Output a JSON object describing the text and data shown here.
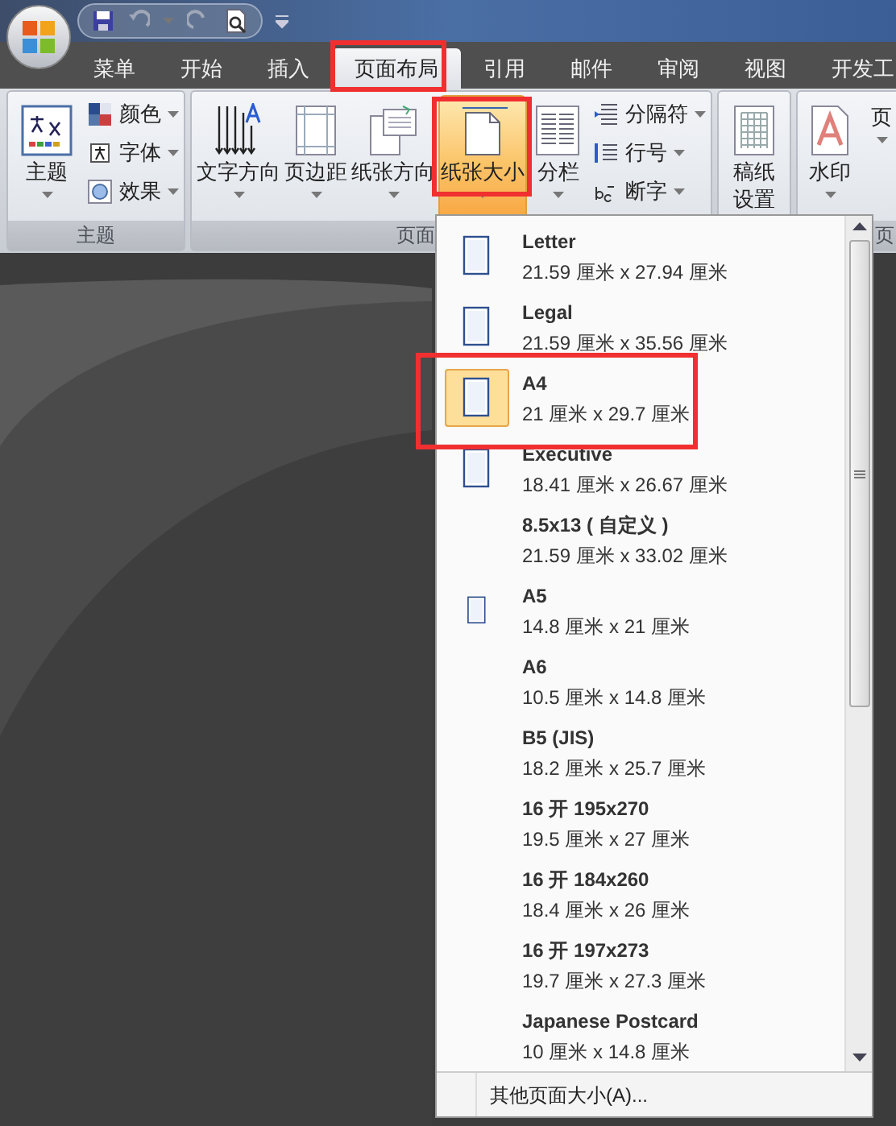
{
  "tabs": [
    {
      "label": "菜单",
      "selected": false
    },
    {
      "label": "开始",
      "selected": false
    },
    {
      "label": "插入",
      "selected": false
    },
    {
      "label": "页面布局",
      "selected": true
    },
    {
      "label": "引用",
      "selected": false
    },
    {
      "label": "邮件",
      "selected": false
    },
    {
      "label": "审阅",
      "selected": false
    },
    {
      "label": "视图",
      "selected": false
    },
    {
      "label": "开发工",
      "selected": false
    }
  ],
  "ribbon": {
    "groups": [
      {
        "label": "主题",
        "controls": [
          {
            "kind": "large",
            "label": "主题",
            "selected": false
          },
          {
            "kind": "small",
            "label": "颜色"
          },
          {
            "kind": "small",
            "label": "字体"
          },
          {
            "kind": "small",
            "label": "效果"
          }
        ]
      },
      {
        "label": "页面",
        "controls": [
          {
            "kind": "large",
            "label": "文字方向",
            "selected": false
          },
          {
            "kind": "large",
            "label": "页边距",
            "selected": false
          },
          {
            "kind": "large",
            "label": "纸张方向",
            "selected": false
          },
          {
            "kind": "large",
            "label": "纸张大小",
            "selected": true
          },
          {
            "kind": "large",
            "label": "分栏",
            "selected": false
          },
          {
            "kind": "small",
            "label": "分隔符"
          },
          {
            "kind": "small",
            "label": "行号"
          },
          {
            "kind": "small",
            "label": "断字"
          }
        ]
      },
      {
        "controls": [
          {
            "kind": "large",
            "label": "稿纸设置",
            "selected": false
          }
        ]
      },
      {
        "label": "页",
        "controls": [
          {
            "kind": "large",
            "label": "水印",
            "selected": false
          },
          {
            "kind": "large",
            "label": "页",
            "selected": false
          }
        ]
      }
    ]
  },
  "paper_menu": {
    "items": [
      {
        "name": "Letter",
        "size": "21.59 厘米 x 27.94 厘米",
        "icon": true,
        "selected": false
      },
      {
        "name": "Legal",
        "size": "21.59 厘米 x 35.56 厘米",
        "icon": true,
        "selected": false
      },
      {
        "name": "A4",
        "size": "21 厘米 x 29.7 厘米",
        "icon": true,
        "selected": true
      },
      {
        "name": "Executive",
        "size": "18.41 厘米 x 26.67 厘米",
        "icon": true,
        "selected": false
      },
      {
        "name": "8.5x13 ( 自定义 )",
        "size": "21.59 厘米 x 33.02 厘米",
        "icon": false,
        "selected": false
      },
      {
        "name": "A5",
        "size": "14.8 厘米 x 21 厘米",
        "icon": true,
        "selected": false
      },
      {
        "name": "A6",
        "size": "10.5 厘米 x 14.8 厘米",
        "icon": false,
        "selected": false
      },
      {
        "name": "B5 (JIS)",
        "size": "18.2 厘米 x 25.7 厘米",
        "icon": false,
        "selected": false
      },
      {
        "name": "16 开 195x270",
        "size": "19.5 厘米 x 27 厘米",
        "icon": false,
        "selected": false
      },
      {
        "name": "16 开 184x260",
        "size": "18.4 厘米 x 26 厘米",
        "icon": false,
        "selected": false
      },
      {
        "name": "16 开 197x273",
        "size": "19.7 厘米 x 27.3 厘米",
        "icon": false,
        "selected": false
      },
      {
        "name": "Japanese Postcard",
        "size": "10 厘米 x 14.8 厘米",
        "icon": false,
        "selected": false
      }
    ],
    "footer": "其他页面大小(A)..."
  }
}
